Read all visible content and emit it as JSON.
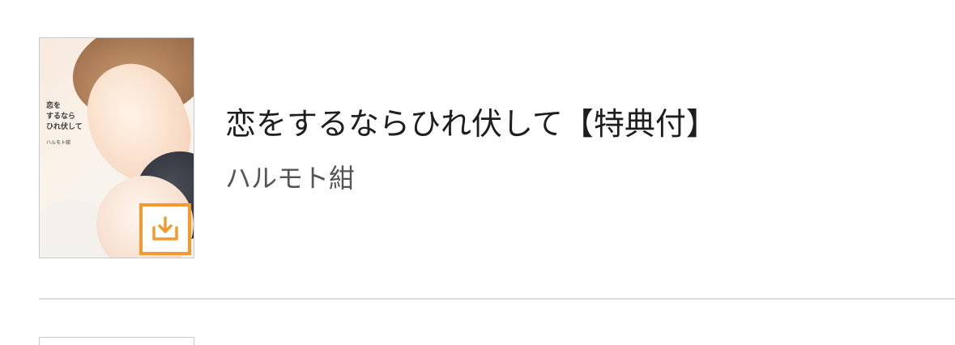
{
  "book": {
    "title": "恋をするならひれ伏して【特典付】",
    "author": "ハルモト紺",
    "cover": {
      "title_line1": "恋を",
      "title_line2": "するなら",
      "title_line3": "ひれ伏して",
      "author": "ハルモト紺"
    },
    "download_icon": "download-icon"
  },
  "colors": {
    "accent": "#f39a2e",
    "title_text": "#1e1e1e",
    "author_text": "#555555",
    "divider": "#dcdcdc"
  }
}
